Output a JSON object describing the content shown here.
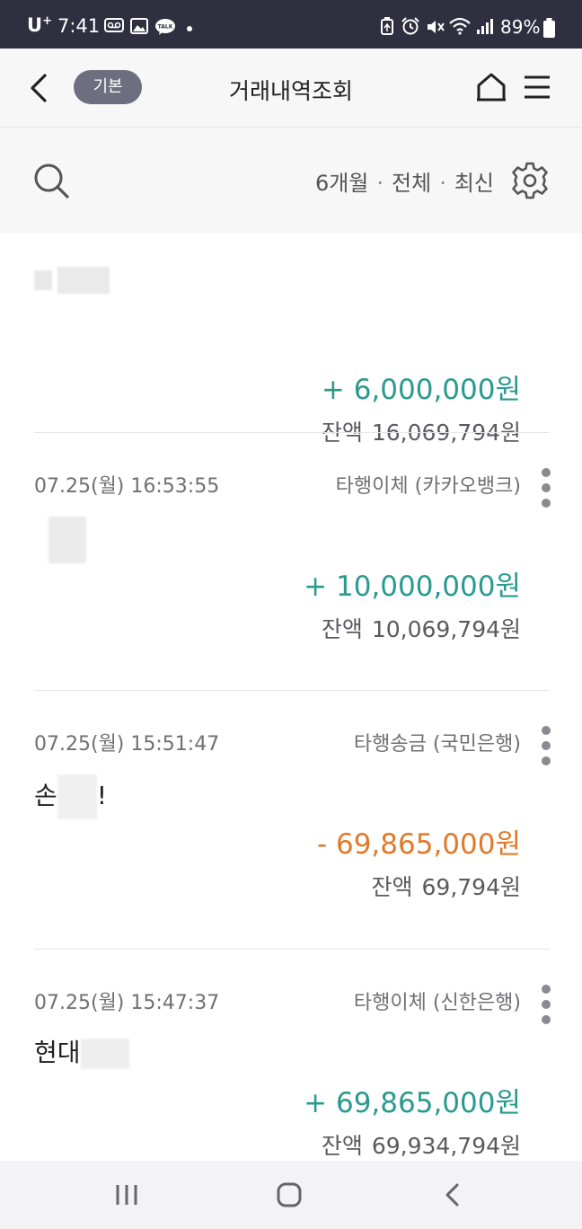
{
  "status_bar": {
    "carrier": "U",
    "carrier_sup": "+",
    "time": "7:41",
    "battery": "89%",
    "icons": [
      "voicemail-icon",
      "gallery-icon",
      "kakaotalk-icon",
      "dot-icon",
      "battery-saver-icon",
      "alarm-icon",
      "mute-icon",
      "wifi-icon",
      "signal-icon",
      "battery-icon"
    ]
  },
  "header": {
    "mode_badge": "기본",
    "title": "거래내역조회"
  },
  "filter": {
    "period": "6개월",
    "scope": "전체",
    "sort": "최신",
    "separator": "·"
  },
  "transactions": [
    {
      "date": "",
      "type": "",
      "name": "",
      "amount": "+ 6,000,000원",
      "direction": "deposit",
      "balance_label": "잔액",
      "balance": "16,069,794원"
    },
    {
      "date": "07.25(월) 16:53:55",
      "type": "타행이체 (카카오뱅크)",
      "name": "",
      "amount": "+ 10,000,000원",
      "direction": "deposit",
      "balance_label": "잔액",
      "balance": "10,069,794원"
    },
    {
      "date": "07.25(월) 15:51:47",
      "type": "타행송금 (국민은행)",
      "name_prefix": "손",
      "name_suffix": "!",
      "amount": "- 69,865,000원",
      "direction": "withdrawal",
      "balance_label": "잔액",
      "balance": "69,794원"
    },
    {
      "date": "07.25(월) 15:47:37",
      "type": "타행이체 (신한은행)",
      "name_prefix": "현대",
      "amount": "+ 69,865,000원",
      "direction": "deposit",
      "balance_label": "잔액",
      "balance": "69,934,794원"
    }
  ],
  "colors": {
    "status_bar_bg": "#2f2f3f",
    "deposit": "#2a9a8e",
    "withdrawal": "#e07a2b",
    "badge_bg": "#6d6f80"
  }
}
